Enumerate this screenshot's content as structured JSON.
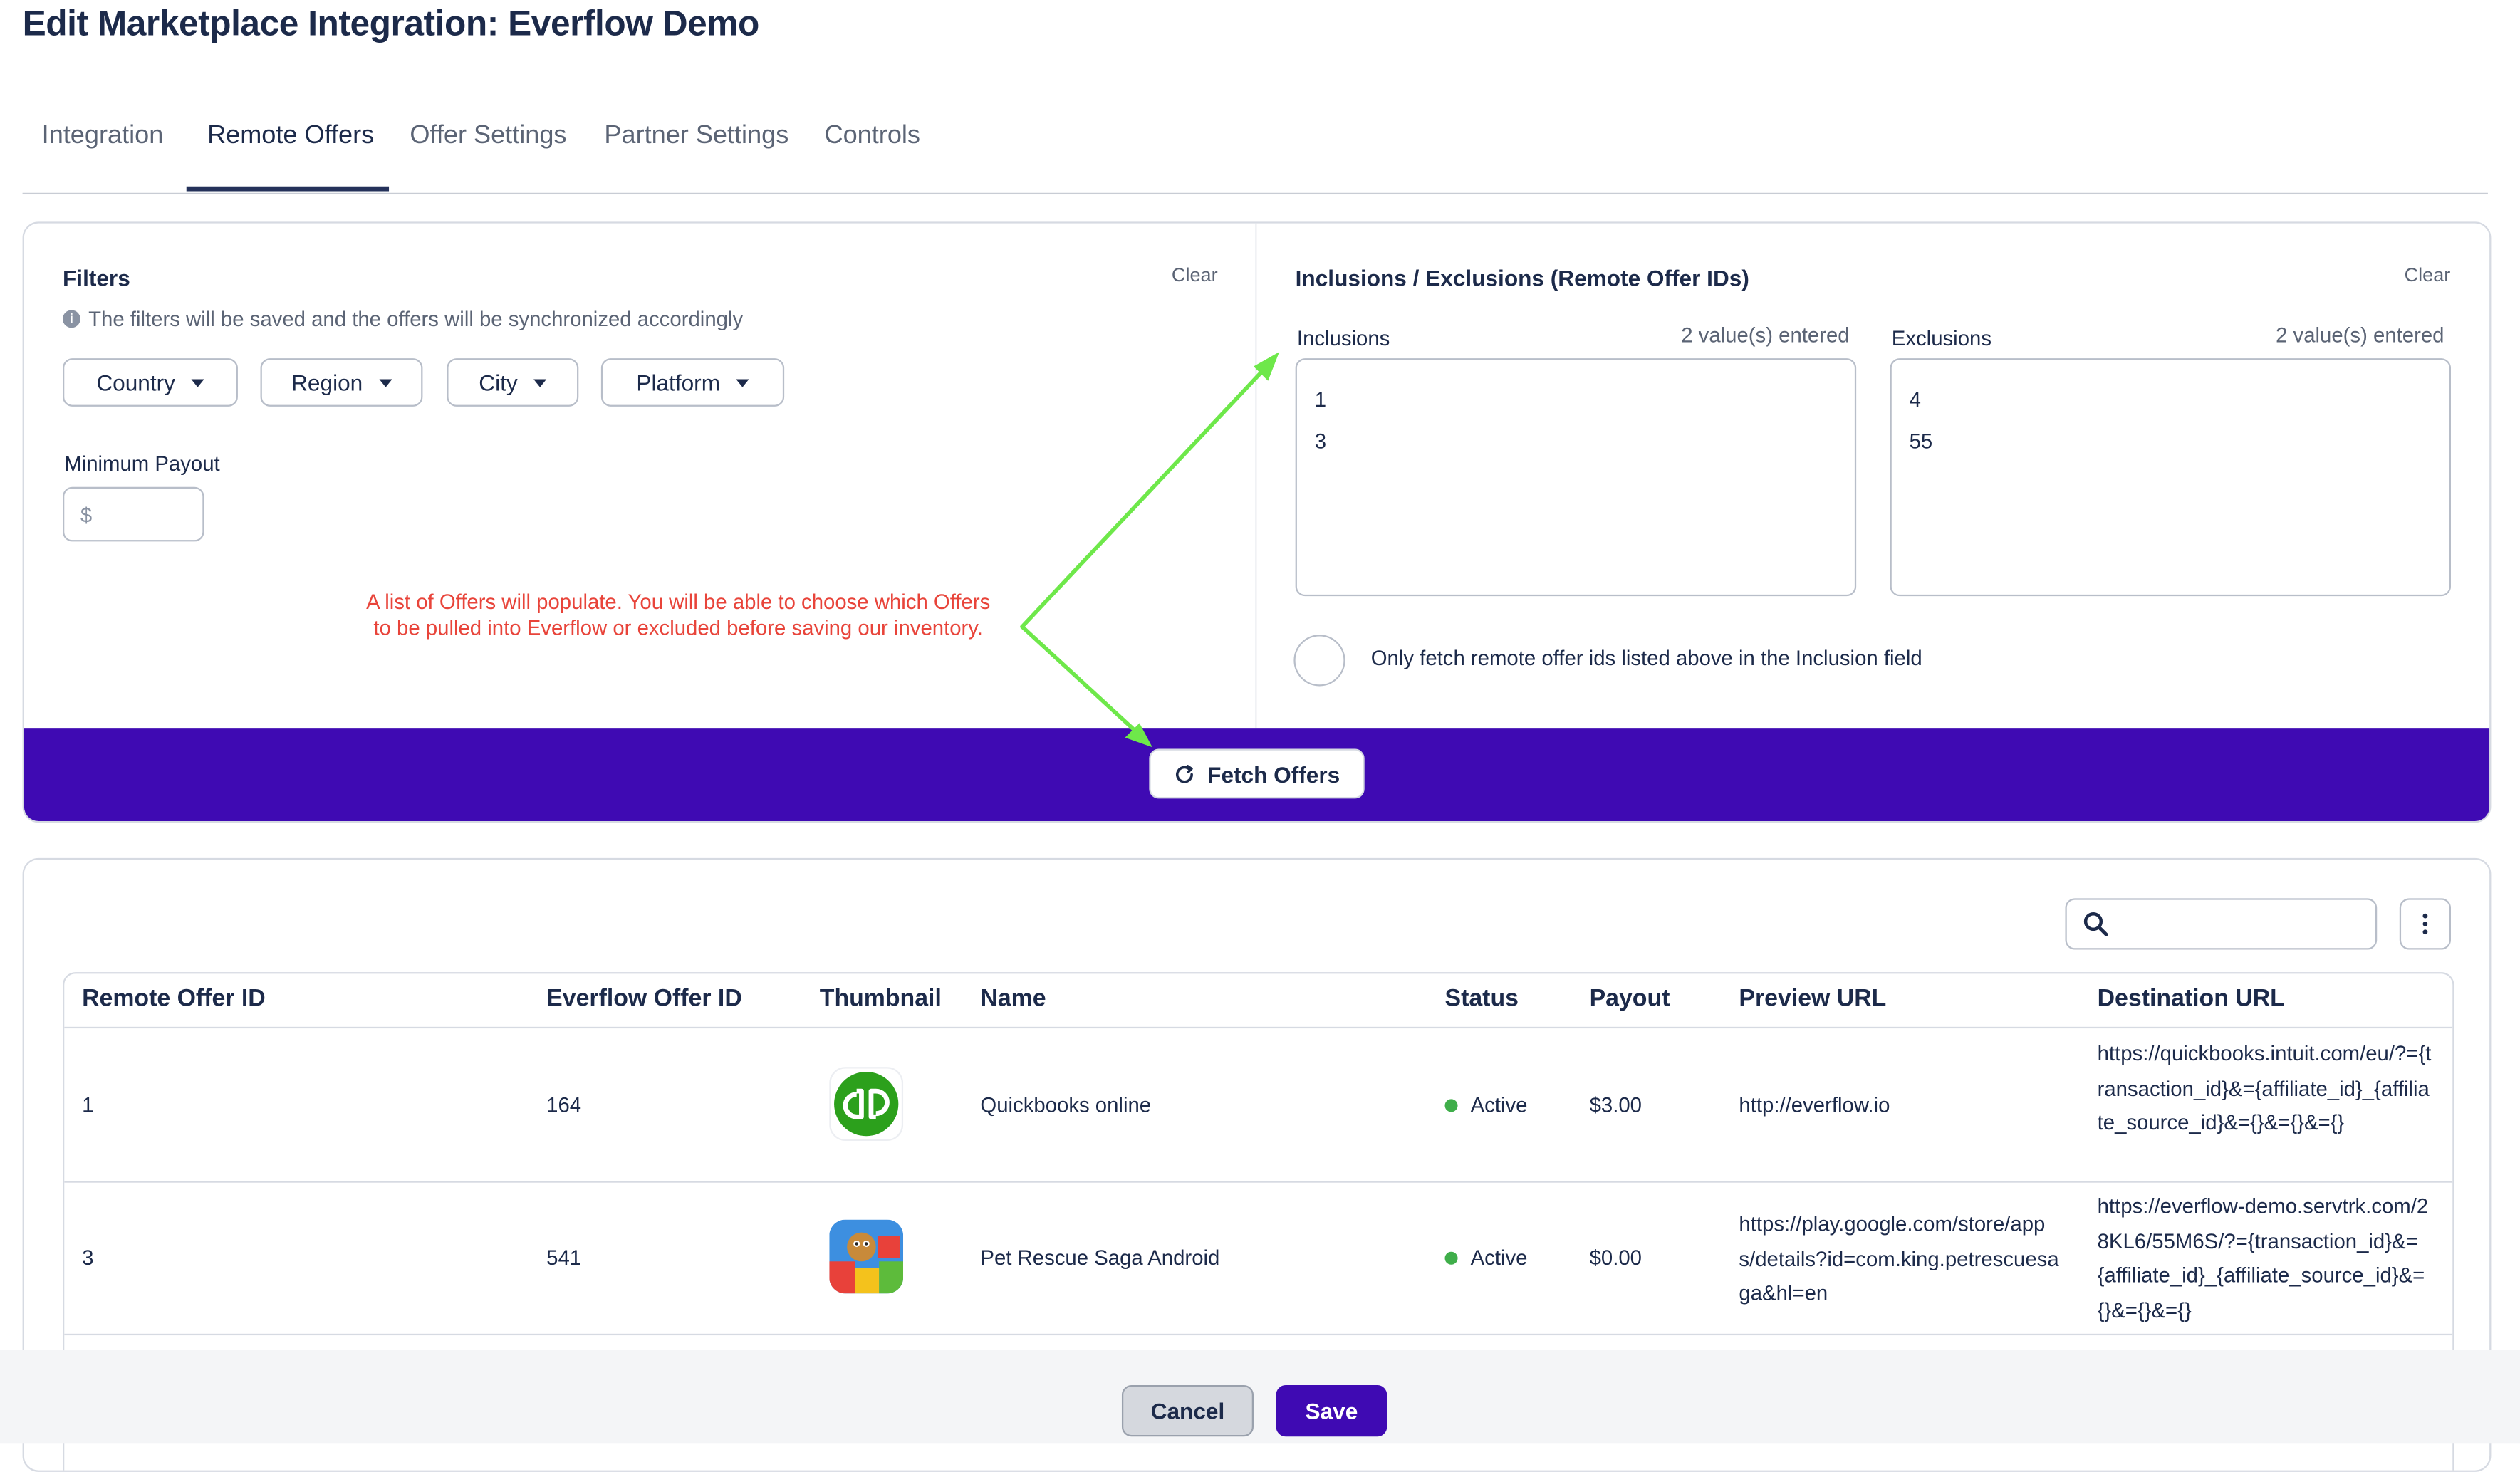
{
  "page": {
    "title": "Edit Marketplace Integration: Everflow Demo"
  },
  "tabs": [
    {
      "label": "Integration"
    },
    {
      "label": "Remote Offers"
    },
    {
      "label": "Offer Settings"
    },
    {
      "label": "Partner Settings"
    },
    {
      "label": "Controls"
    }
  ],
  "filters": {
    "title": "Filters",
    "clear": "Clear",
    "info": "The filters will be saved and the offers will be synchronized accordingly",
    "buttons": [
      {
        "label": "Country"
      },
      {
        "label": "Region"
      },
      {
        "label": "City"
      },
      {
        "label": "Platform"
      }
    ],
    "min_payout_label": "Minimum Payout",
    "min_payout_placeholder": "$"
  },
  "annotation": {
    "line1": "A list of Offers will populate. You will be able to choose which Offers",
    "line2": "to be pulled into Everflow or excluded before saving our inventory."
  },
  "inclusions_exclusions": {
    "title": "Inclusions / Exclusions (Remote Offer IDs)",
    "clear": "Clear",
    "inclusions": {
      "label": "Inclusions",
      "count": "2 value(s) entered",
      "values": [
        "1",
        "3"
      ]
    },
    "exclusions": {
      "label": "Exclusions",
      "count": "2 value(s) entered",
      "values": [
        "4",
        "55"
      ]
    },
    "only_fetch_label": "Only fetch remote offer ids listed above in the Inclusion field"
  },
  "fetch": {
    "label": "Fetch Offers"
  },
  "table": {
    "headers": [
      "Remote Offer ID",
      "Everflow Offer ID",
      "Thumbnail",
      "Name",
      "Status",
      "Payout",
      "Preview URL",
      "Destination URL"
    ],
    "rows": [
      {
        "remote_id": "1",
        "everflow_id": "164",
        "name": "Quickbooks online",
        "status": "Active",
        "payout": "$3.00",
        "preview_url": "http://everflow.io",
        "destination_url": "https://quickbooks.intuit.com/eu/?={transaction_id}&={affiliate_id}_{affiliate_source_id}&={}&={}&={}",
        "thumbnail_icon": "quickbooks-logo-icon"
      },
      {
        "remote_id": "3",
        "everflow_id": "541",
        "name": "Pet Rescue Saga Android",
        "status": "Active",
        "payout": "$0.00",
        "preview_url": "https://play.google.com/store/apps/details?id=com.king.petrescuesaga&hl=en",
        "destination_url": "https://everflow-demo.servtrk.com/28KL6/55M6S/?={transaction_id}&={affiliate_id}_{affiliate_source_id}&={}&={}&={}",
        "thumbnail_icon": "pet-rescue-saga-icon"
      }
    ]
  },
  "footer": {
    "cancel": "Cancel",
    "save": "Save"
  },
  "colors": {
    "accent": "#3f0ab3",
    "annotation": "#e8443a",
    "arrow": "#6ee84a",
    "status_active": "#3fae4a",
    "quickbooks_green": "#2ca01c"
  }
}
